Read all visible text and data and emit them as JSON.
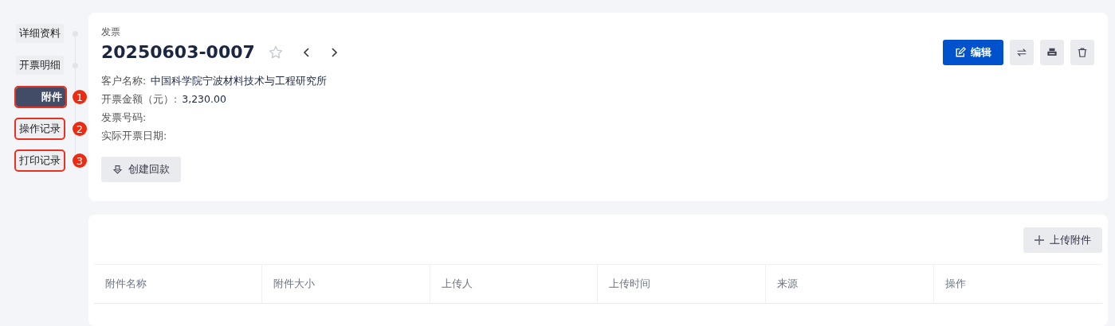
{
  "sidebar": {
    "items": [
      {
        "label": "详细资料",
        "selected": false,
        "annotated": false
      },
      {
        "label": "开票明细",
        "selected": false,
        "annotated": false
      },
      {
        "label": "附件",
        "selected": true,
        "annotated": true,
        "callout": "1"
      },
      {
        "label": "操作记录",
        "selected": false,
        "annotated": true,
        "callout": "2"
      },
      {
        "label": "打印记录",
        "selected": false,
        "annotated": true,
        "callout": "3"
      }
    ]
  },
  "header": {
    "type_label": "发票",
    "number": "20250603-0007",
    "starred": false,
    "actions": [
      {
        "kind": "edit",
        "label": "编辑"
      },
      {
        "kind": "swap"
      },
      {
        "kind": "print"
      },
      {
        "kind": "delete"
      }
    ],
    "fields": [
      {
        "label": "客户名称:",
        "value": "中国科学院宁波材料技术与工程研究所"
      },
      {
        "label": "开票金额（元）:",
        "value": "3,230.00"
      },
      {
        "label": "发票号码:"
      },
      {
        "label": "实际开票日期:"
      }
    ],
    "create_button": "创建回款"
  },
  "attachments": {
    "upload_button": "上传附件",
    "table": {
      "columns": [
        "附件名称",
        "附件大小",
        "上传人",
        "上传时间",
        "来源",
        "操作"
      ]
    }
  }
}
